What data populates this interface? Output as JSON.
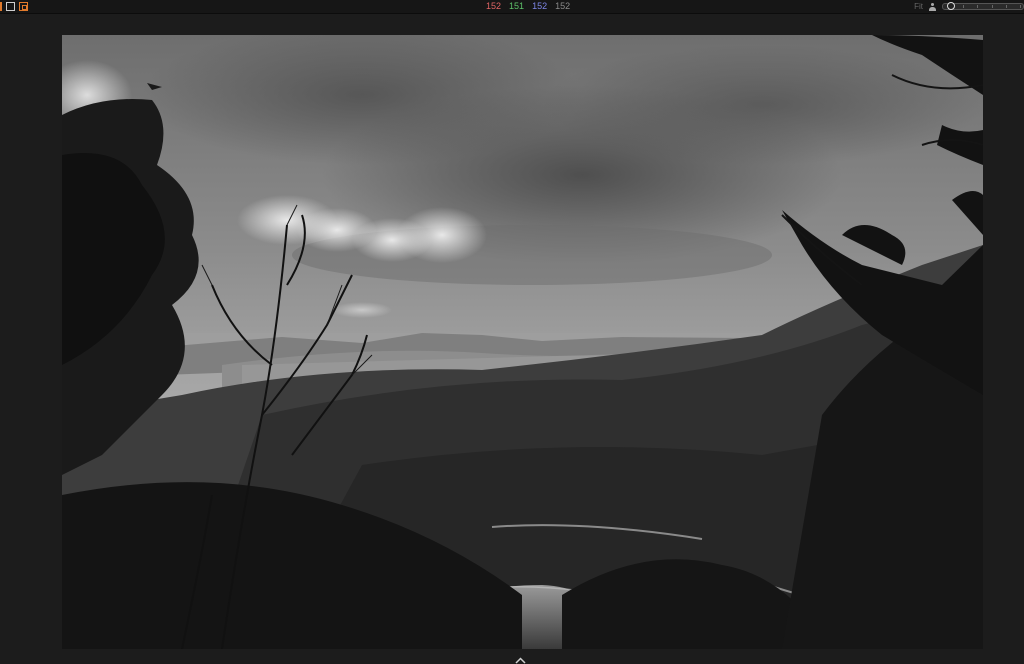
{
  "toolbar": {
    "left_icons": [
      "crop-frame-icon",
      "single-view-icon",
      "compare-view-icon"
    ],
    "pixel_readout": {
      "r": "152",
      "g": "151",
      "b": "152",
      "l": "152",
      "colors": {
        "r": "#e06464",
        "g": "#5ec26a",
        "b": "#7e86e6",
        "l": "#8a8a8a"
      }
    },
    "zoom_label": "Fit",
    "zoom_level": 0.05
  },
  "viewer": {
    "photo_description_icon": "bw-landscape-photo",
    "bottom_toggle_icon": "chevron-up-icon"
  },
  "colors": {
    "background": "#1c1c1c",
    "toolbar": "#161616",
    "accent": "#e07a2c"
  }
}
